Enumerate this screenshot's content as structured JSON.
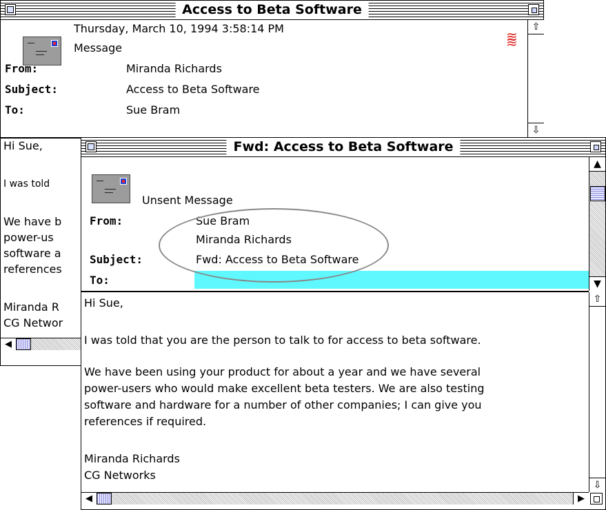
{
  "back_window": {
    "title": "Access to Beta Software",
    "date": "Thursday, March 10, 1994 3:58:14 PM",
    "status": "Message",
    "labels": {
      "from": "From:",
      "subject": "Subject:",
      "to": "To:"
    },
    "from": "Miranda Richards",
    "subject": "Access to Beta Software",
    "to": "Sue Bram",
    "body_partial": [
      "Hi Sue,",
      "I was told",
      "We have b",
      "power-us",
      "software a",
      "references",
      "Miranda R",
      "CG Networ"
    ]
  },
  "front_window": {
    "title": "Fwd: Access to Beta Software",
    "status": "Unsent Message",
    "labels": {
      "from": "From:",
      "subject": "Subject:",
      "to": "To:"
    },
    "from": "Sue Bram",
    "from_original": "Miranda Richards",
    "subject": "Fwd: Access to Beta Software",
    "to": "",
    "body": {
      "greeting": "Hi Sue,",
      "para1": "I was told that you are the person to talk to for access to beta software.",
      "para2": "We have been using your product for about a year and we have several\npower-users who would make excellent beta testers. We are also testing\nsoftware and hardware for a number of other companies; I can give you\nreferences if required.",
      "signature": "Miranda Richards\nCG Networks"
    }
  },
  "icons": {
    "up": "▲",
    "down": "▼",
    "left": "◀",
    "right": "▶",
    "hollow_up": "⇧",
    "hollow_down": "⇩",
    "hollow_left": "⇦",
    "hollow_right": "⇨"
  },
  "colors": {
    "to_field_highlight": "#5ff8ff",
    "priority_red": "#e0231f",
    "annotation_ellipse": "#888888"
  }
}
